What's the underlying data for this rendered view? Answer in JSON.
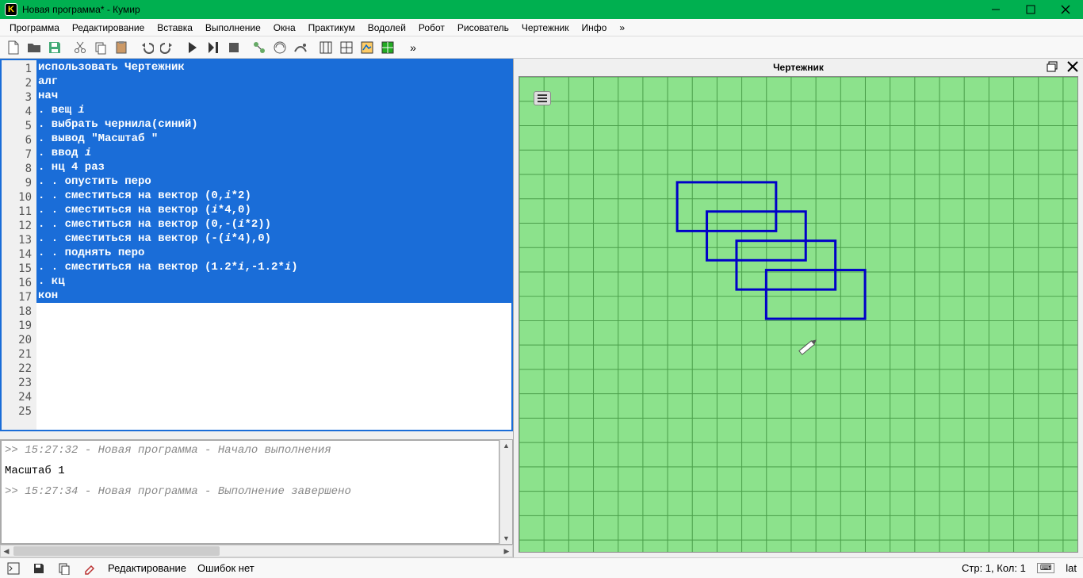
{
  "window": {
    "title": "Новая программа* - Кумир",
    "logo": "K"
  },
  "menu": {
    "items": [
      "Программа",
      "Редактирование",
      "Вставка",
      "Выполнение",
      "Окна",
      "Практикум",
      "Водолей",
      "Робот",
      "Рисователь",
      "Чертежник",
      "Инфо",
      "»"
    ]
  },
  "code": {
    "lines": [
      "использовать Чертежник",
      "алг",
      "нач",
      ". вещ i",
      ". выбрать чернила(синий)",
      ". вывод \"Масштаб \"",
      ". ввод i",
      ". нц 4 раз",
      ". . опустить перо",
      ". . сместиться на вектор (0,i*2)",
      ". . сместиться на вектор (i*4,0)",
      ". . сместиться на вектор (0,-(i*2))",
      ". . сместиться на вектор (-(i*4),0)",
      ". . поднять перо",
      ". . сместиться на вектор (1.2*i,-1.2*i)",
      ". кц",
      "кон"
    ],
    "total_visible_lines": 25,
    "selected_until": 17
  },
  "console": {
    "l1": ">> 15:27:32 - Новая программа - Начало выполнения",
    "io": "Масштаб 1",
    "l2": ">> 15:27:34 - Новая программа - Выполнение завершено"
  },
  "drawer": {
    "title": "Чертежник"
  },
  "status": {
    "mode": "Редактирование",
    "errors": "Ошибок нет",
    "pos": "Стр: 1, Кол: 1",
    "kb1": "⌨",
    "kb2": "lat"
  }
}
